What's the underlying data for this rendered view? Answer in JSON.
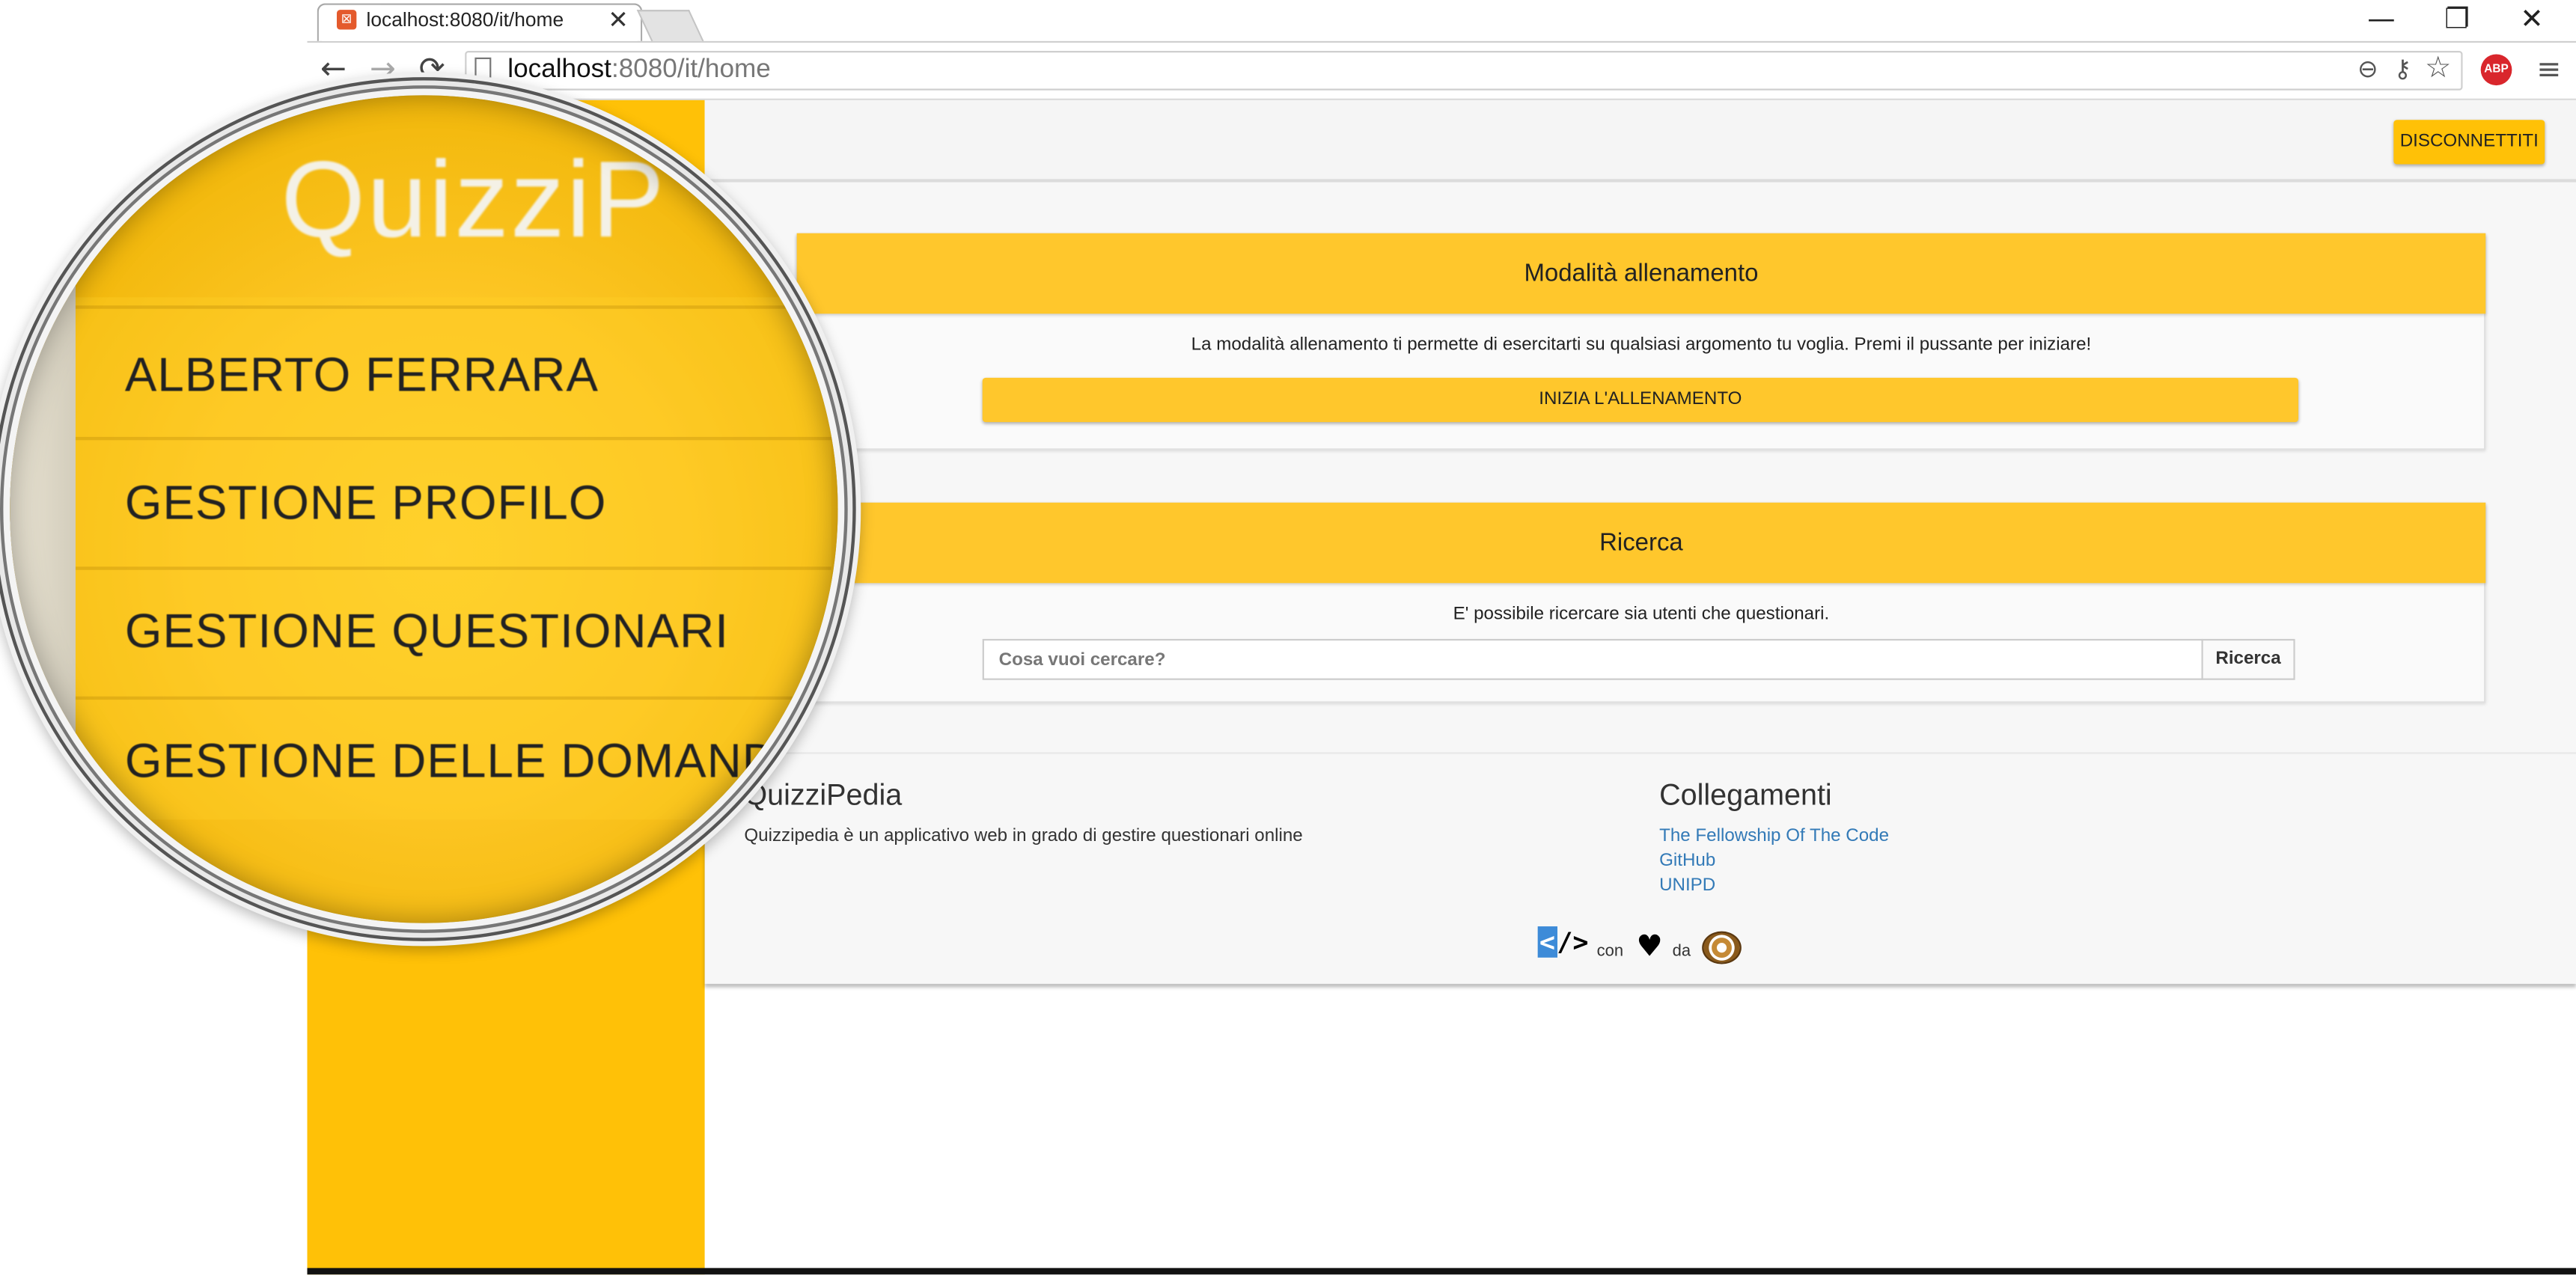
{
  "browser": {
    "tab_title": "localhost:8080/it/home",
    "tab_close": "✕",
    "url_host": "localhost",
    "url_rest": ":8080/it/home",
    "abp_label": "ABP",
    "window_minimize": "—",
    "window_restore": "❐",
    "window_close": "✕",
    "back_icon": "←",
    "forward_icon": "→",
    "reload_icon": "⟳",
    "zoom_icon": "⊖",
    "key_icon": "⚷",
    "star_icon": "☆",
    "menu_icon": "≡",
    "favicon_glyph": "⊠"
  },
  "sidebar": {
    "logo": "QuizziP",
    "items": [
      {
        "label": "ALBERTO FERRARA"
      },
      {
        "label": "GESTIONE PROFILO"
      },
      {
        "label": "GESTIONE QUESTIONARI"
      },
      {
        "label": "GESTIONE DELLE DOMANDE"
      }
    ]
  },
  "header": {
    "logout_label": "DISCONNETTITI"
  },
  "training_card": {
    "title": "Modalità allenamento",
    "description": "La modalità allenamento ti permette di esercitarti su qualsiasi argomento tu voglia. Premi il pussante per iniziare!",
    "button_label": "INIZIA L'ALLENAMENTO"
  },
  "search_card": {
    "title": "Ricerca",
    "description": "E' possibile ricercare sia utenti che questionari.",
    "placeholder": "Cosa vuoi cercare?",
    "button_label": "Ricerca"
  },
  "footer": {
    "about_title": "QuizziPedia",
    "about_text": "Quizzipedia è un applicativo web in grado di gestire questionari online",
    "links_title": "Collegamenti",
    "links": [
      {
        "label": "The Fellowship Of The Code"
      },
      {
        "label": "GitHub"
      },
      {
        "label": "UNIPD"
      }
    ],
    "credit_code_lt": "<",
    "credit_code_rest": "/>",
    "credit_con": "con",
    "credit_heart": "♥",
    "credit_da": "da"
  },
  "colors": {
    "accent": "#FFC107",
    "card_header": "#FFC72C",
    "link": "#337ab7"
  }
}
